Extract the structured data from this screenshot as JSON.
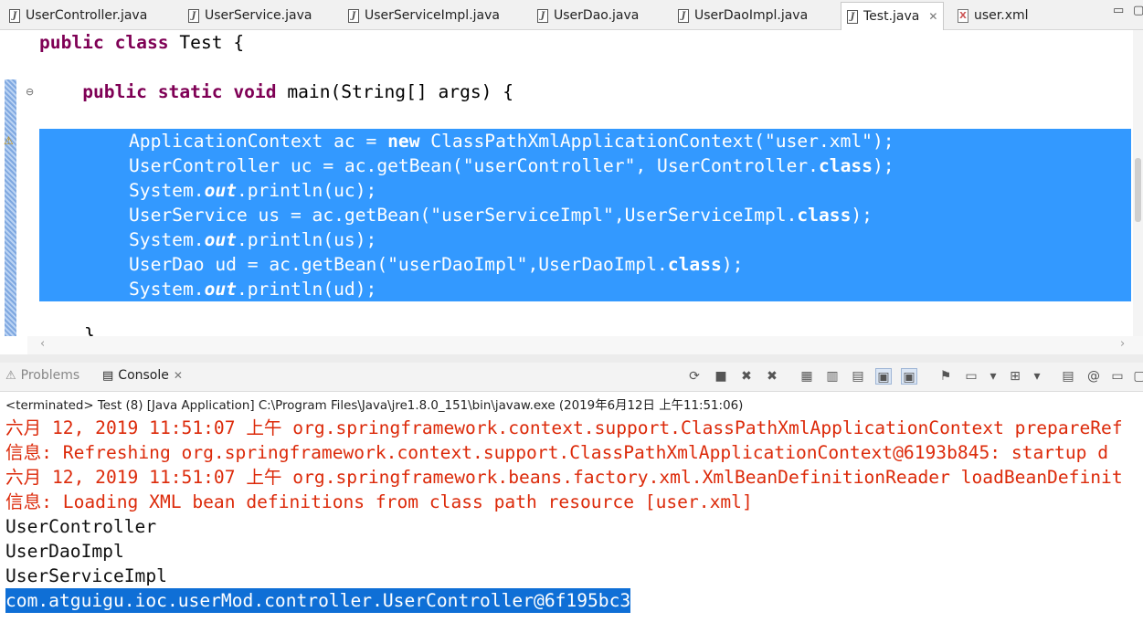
{
  "editor_tabs": [
    {
      "label": "UserController.java",
      "type": "java",
      "active": false
    },
    {
      "label": "UserService.java",
      "type": "java",
      "active": false
    },
    {
      "label": "UserServiceImpl.java",
      "type": "java",
      "active": false
    },
    {
      "label": "UserDao.java",
      "type": "java",
      "active": false
    },
    {
      "label": "UserDaoImpl.java",
      "type": "java",
      "active": false
    },
    {
      "label": "Test.java",
      "type": "java",
      "active": true
    },
    {
      "label": "user.xml",
      "type": "xml",
      "active": false
    }
  ],
  "code": {
    "line1": {
      "kw1": "public",
      "kw2": "class",
      "rest": " Test {"
    },
    "line2": {
      "kw1": "public",
      "kw2": "static",
      "kw3": "void",
      "rest": " main(String[] args) {"
    },
    "line3": {
      "a": "ApplicationContext ac = ",
      "kw": "new",
      "b": " ClassPathXmlApplicationContext(\"user.xml\");"
    },
    "line4": {
      "a": "UserController uc = ac.getBean(\"userController\", UserController.",
      "kw": "class",
      "b": ");"
    },
    "line5": {
      "a": "System.",
      "it": "out",
      "b": ".println(uc);"
    },
    "line6": {
      "a": "UserService us = ac.getBean(\"userServiceImpl\",UserServiceImpl.",
      "kw": "class",
      "b": ");"
    },
    "line7": {
      "a": "System.",
      "it": "out",
      "b": ".println(us);"
    },
    "line8": {
      "a": "UserDao ud = ac.getBean(\"userDaoImpl\",UserDaoImpl.",
      "kw": "class",
      "b": ");"
    },
    "line9": {
      "a": "System.",
      "it": "out",
      "b": ".println(ud);"
    },
    "line10": "}"
  },
  "views": {
    "problems_label": "Problems",
    "console_label": "Console"
  },
  "console": {
    "status": "<terminated> Test (8) [Java Application] C:\\Program Files\\Java\\jre1.8.0_151\\bin\\javaw.exe (2019年6月12日 上午11:51:06)",
    "lines": [
      "六月 12, 2019 11:51:07 上午 org.springframework.context.support.ClassPathXmlApplicationContext prepareRef",
      "信息: Refreshing org.springframework.context.support.ClassPathXmlApplicationContext@6193b845: startup d",
      "六月 12, 2019 11:51:07 上午 org.springframework.beans.factory.xml.XmlBeanDefinitionReader loadBeanDefinit",
      "信息: Loading XML bean definitions from class path resource [user.xml]",
      "UserController",
      "UserDaoImpl",
      "UserServiceImpl",
      "com.atguigu.ioc.userMod.controller.UserController@6f195bc3"
    ]
  },
  "colors": {
    "keyword": "#7f0055",
    "selection": "#3399ff",
    "console_error": "#dc2a0a"
  }
}
